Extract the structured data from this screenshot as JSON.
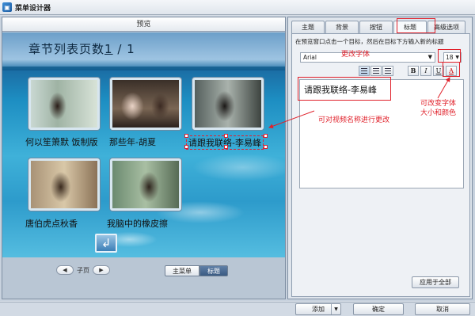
{
  "window": {
    "title": "菜单设计器"
  },
  "preview": {
    "header": "预览",
    "page_title_prefix": "章节列表页数",
    "page_current": "1",
    "page_sep": " / ",
    "page_total": "1",
    "items": [
      {
        "caption": "何以笙箫默 饭制版"
      },
      {
        "caption": "那些年-胡夏"
      },
      {
        "caption": "请跟我联络-李易峰"
      },
      {
        "caption": "唐伯虎点秋香"
      },
      {
        "caption": "我脑中的橡皮擦"
      }
    ],
    "return_icon": "return-arrow-icon",
    "pager": {
      "prev": "◀",
      "label": "子页",
      "next": "▶"
    },
    "mode_tabs": [
      {
        "label": "主菜单"
      },
      {
        "label": "标题"
      }
    ]
  },
  "editor": {
    "tabs": [
      {
        "label": "主题"
      },
      {
        "label": "背景"
      },
      {
        "label": "按钮"
      },
      {
        "label": "标题"
      },
      {
        "label": "高级选项"
      }
    ],
    "active_tab": "标题",
    "hint": "在预览窗口点击一个目标，然后在目标下方输入新的标题",
    "font": "Arial",
    "size": "18",
    "format_buttons": {
      "bold": "B",
      "italic": "I",
      "underline": "U",
      "color": "A"
    },
    "text_value": "请跟我联络-李易峰",
    "apply_all": "应用于全部"
  },
  "annotations": {
    "change_font": "更改字体",
    "rename_video": "可对视频名称进行更改",
    "size_color_line1": "可改变字体",
    "size_color_line2": "大小和颜色"
  },
  "footer": {
    "add": "添加",
    "confirm": "确定",
    "cancel": "取消"
  },
  "colors": {
    "annotation_red": "#e0202a",
    "accent_blue": "#3a5a82"
  }
}
